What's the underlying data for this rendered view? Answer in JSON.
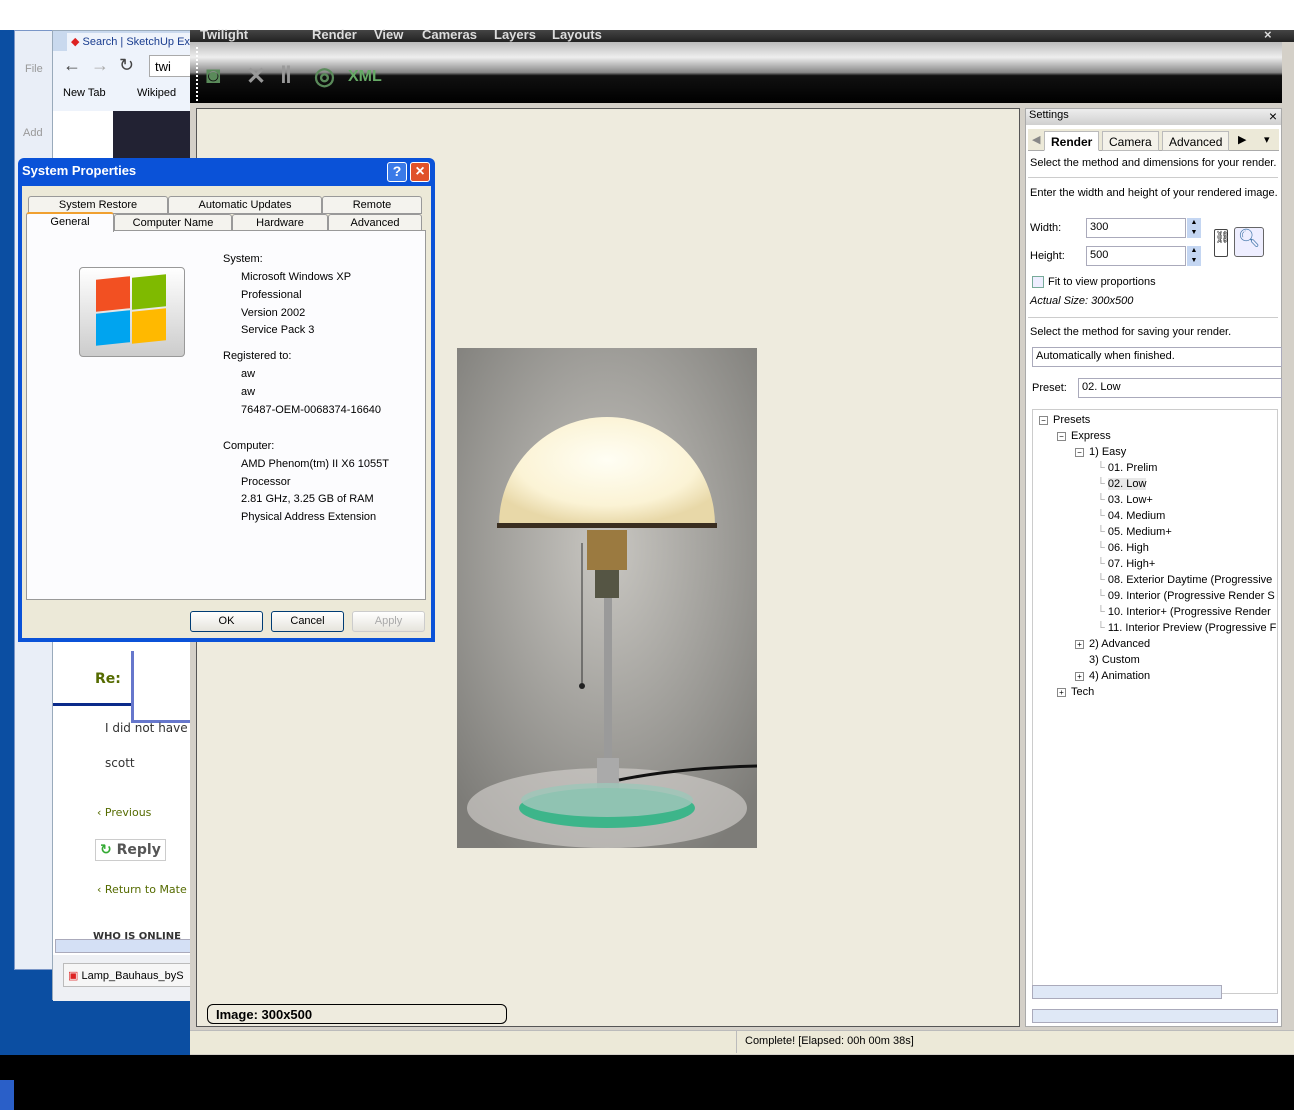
{
  "browser": {
    "tab_title": "Search | SketchUp Ex",
    "address": "twi",
    "bookmarks": [
      "New Tab",
      "Wikiped"
    ],
    "explorer_menu": "File",
    "explorer_address": "Add"
  },
  "forum": {
    "heading": "Re:",
    "post_line": "I did not have",
    "signature": "scott",
    "previous": "Previous",
    "reply": "Reply",
    "return_link": "Return to Mate",
    "who_online": "WHO IS ONLINE",
    "download": "Lamp_Bauhaus_byS"
  },
  "twilight": {
    "app_title": "Twilight",
    "menu": [
      "Render",
      "View",
      "Cameras",
      "Layers",
      "Layouts"
    ],
    "toolbar_icons": [
      "render-icon",
      "stop-icon",
      "pause-icon",
      "refresh-icon",
      "xml-icon"
    ],
    "close": "×",
    "image_label": "Image: 300x500",
    "status": "Complete!  [Elapsed: 00h 00m 38s]"
  },
  "settings": {
    "title": "Settings",
    "close": "×",
    "tabs": [
      "Render",
      "Camera",
      "Advanced"
    ],
    "active_tab": "Render",
    "method_text": "Select the method and dimensions for your render.",
    "size_text": "Enter the width and height of your rendered image.",
    "width_label": "Width:",
    "width_value": "300",
    "height_label": "Height:",
    "height_value": "500",
    "fit_label": "Fit to view proportions",
    "fit_checked": false,
    "actual_size": "Actual Size: 300x500",
    "save_text": "Select the method for saving your render.",
    "save_value": "Automatically when finished.",
    "preset_label": "Preset:",
    "preset_value": "02. Low",
    "tree": {
      "presets": "Presets",
      "express": "Express",
      "easy": "1) Easy",
      "easy_items": [
        "01. Prelim",
        "02. Low",
        "03. Low+",
        "04. Medium",
        "05. Medium+",
        "06. High",
        "07. High+",
        "08. Exterior Daytime (Progressive",
        "09. Interior (Progressive Render S",
        "10. Interior+ (Progressive Render",
        "11. Interior Preview (Progressive F"
      ],
      "selected": "02. Low",
      "advanced": "2) Advanced",
      "custom": "3) Custom",
      "animation": "4) Animation",
      "tech": "Tech"
    }
  },
  "system_properties": {
    "title": "System Properties",
    "help": "?",
    "close": "×",
    "tabs_row1": [
      "System Restore",
      "Automatic Updates",
      "Remote"
    ],
    "tabs_row2": [
      "General",
      "Computer Name",
      "Hardware",
      "Advanced"
    ],
    "active_tab": "General",
    "system_label": "System:",
    "system": [
      "Microsoft Windows XP",
      "Professional",
      "Version 2002",
      "Service Pack 3"
    ],
    "registered_label": "Registered to:",
    "registered": [
      "aw",
      "aw",
      "76487-OEM-0068374-16640"
    ],
    "computer_label": "Computer:",
    "computer": [
      "AMD Phenom(tm) II X6 1055T",
      "Processor",
      "2.81 GHz, 3.25 GB of RAM",
      "Physical Address Extension"
    ],
    "ok": "OK",
    "cancel": "Cancel",
    "apply": "Apply"
  }
}
